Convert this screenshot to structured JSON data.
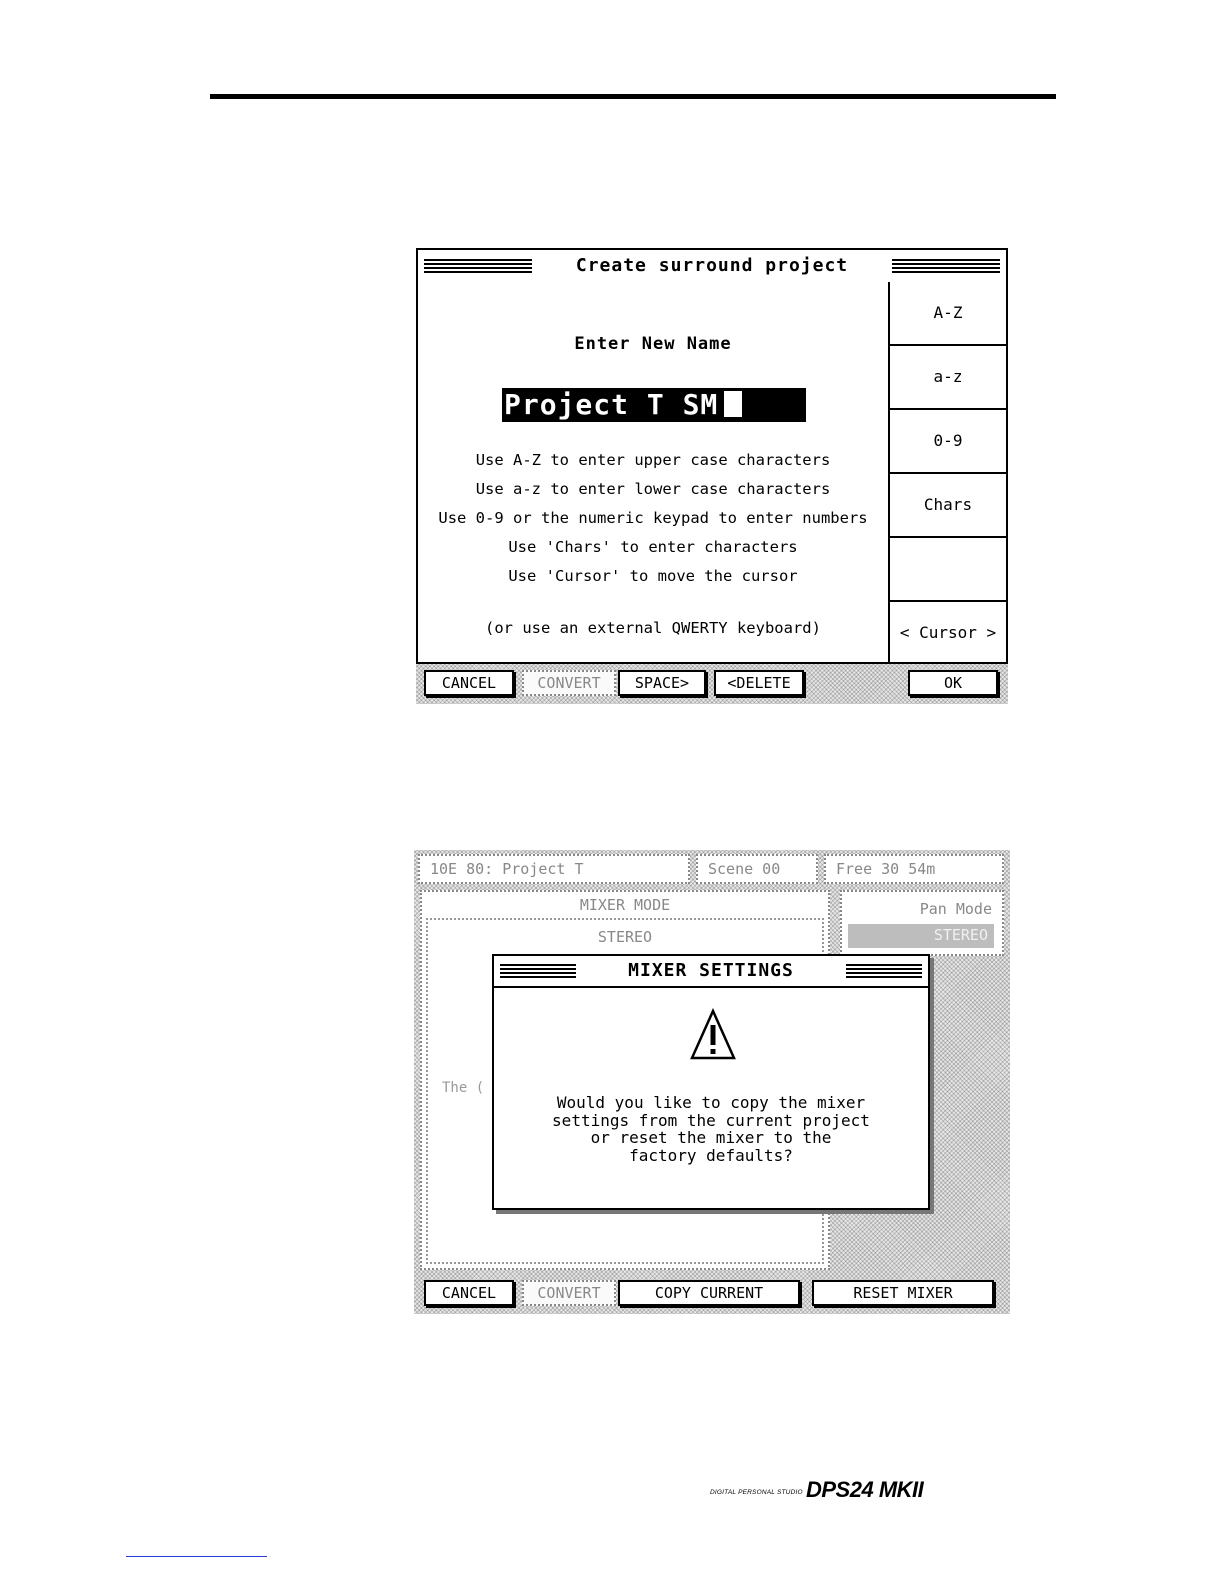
{
  "screen1": {
    "title": "Create surround project",
    "heading": "Enter New Name",
    "name_value": "Project T SM",
    "help_lines": [
      "Use A-Z to enter upper case characters",
      "Use a-z to enter lower case characters",
      "Use 0-9 or the numeric keypad to enter numbers",
      "Use 'Chars' to enter characters",
      "Use 'Cursor' to move the cursor"
    ],
    "keyboard_note": "(or use an external QWERTY keyboard)",
    "side_buttons": [
      "A-Z",
      "a-z",
      "0-9",
      "Chars",
      "",
      "< Cursor >"
    ],
    "bottom_buttons": {
      "cancel": "CANCEL",
      "convert": "CONVERT",
      "space": "SPACE>",
      "delete": "<DELETE",
      "ok": "OK"
    }
  },
  "screen2": {
    "status": {
      "project": "10E 80: Project T",
      "scene": "Scene 00",
      "free": "Free 30 54m"
    },
    "mixer_mode_label": "MIXER MODE",
    "stereo_label": "STEREO",
    "pan_mode_label": "Pan Mode",
    "pan_mode_value": "STEREO",
    "dialog": {
      "title": "MIXER SETTINGS",
      "message": [
        "Would you like to copy the mixer",
        "settings from the current project",
        "or reset the mixer to the",
        "factory defaults?"
      ]
    },
    "bottom_buttons": {
      "cancel": "CANCEL",
      "convert": "CONVERT",
      "copy_current": "COPY CURRENT",
      "reset_mixer": "RESET MIXER"
    }
  },
  "footer": {
    "brand_small": "DIGITAL PERSONAL STUDIO",
    "brand_model": "DPS24 MKII"
  }
}
